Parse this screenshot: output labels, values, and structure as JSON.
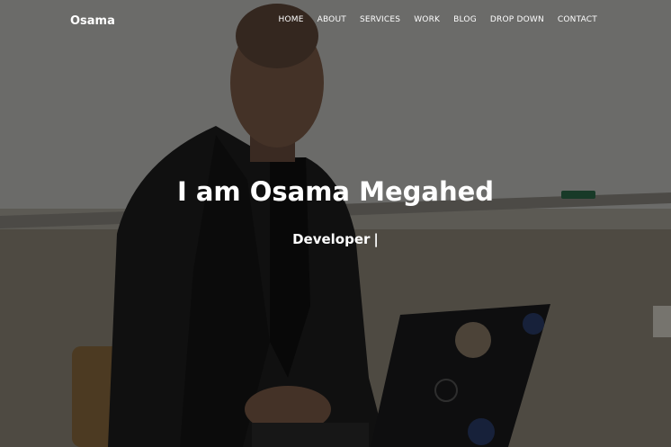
{
  "brand": {
    "name": "Osama"
  },
  "nav": {
    "items": [
      {
        "label": "HOME"
      },
      {
        "label": "ABOUT"
      },
      {
        "label": "SERVICES"
      },
      {
        "label": "WORK"
      },
      {
        "label": "BLOG"
      },
      {
        "label": "DROP DOWN"
      },
      {
        "label": "CONTACT"
      }
    ]
  },
  "hero": {
    "title": "I am Osama Megahed",
    "typed_text": "Developer",
    "cursor": "|"
  },
  "colors": {
    "text": "#ffffff",
    "overlay": "rgba(0,0,0,0.45)",
    "wall": "#8f8b80",
    "jacket": "#1c1c1c"
  }
}
